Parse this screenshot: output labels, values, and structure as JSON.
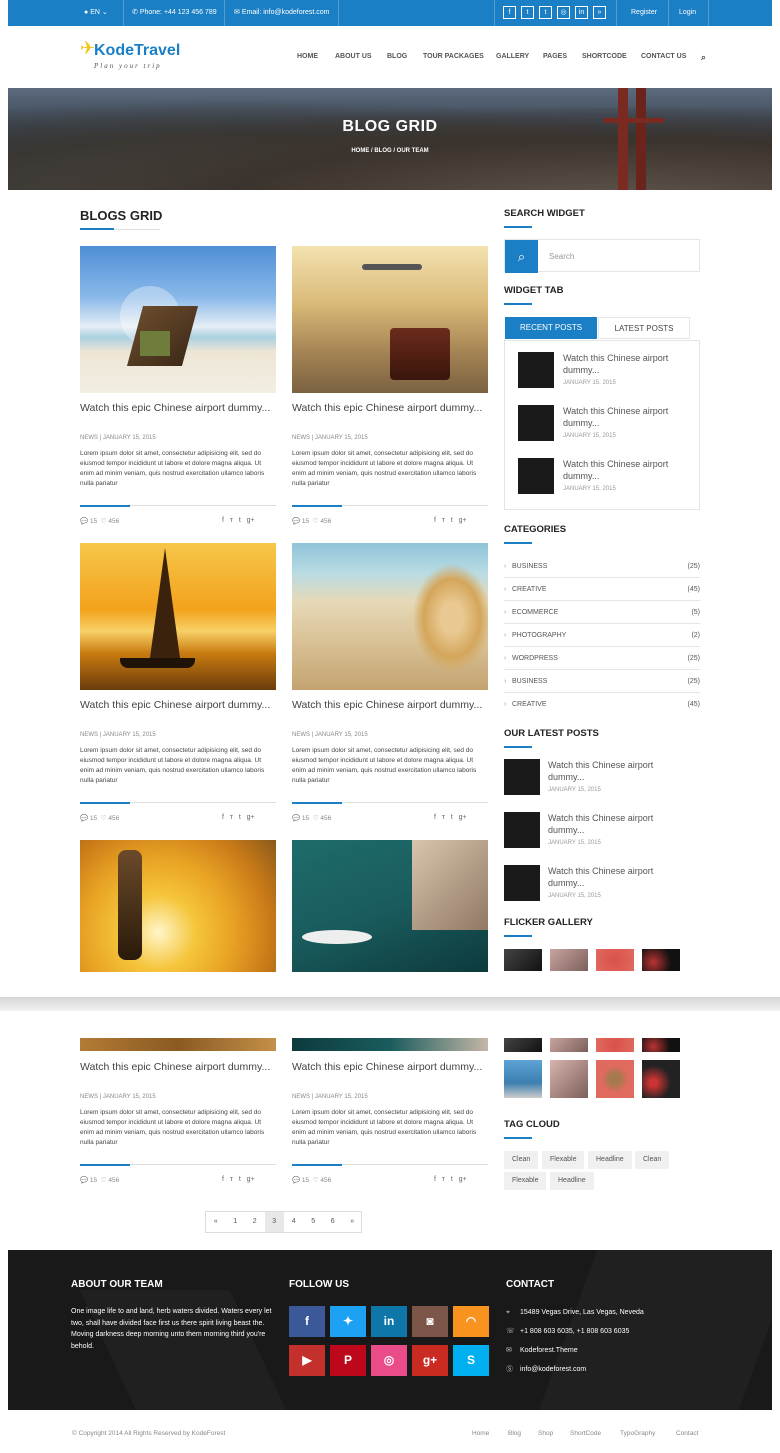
{
  "topbar": {
    "lang": "EN",
    "phone": "Phone: +44 123 456 789",
    "email": "Email: info@kodeforest.com",
    "socials": [
      "f",
      "t",
      "t",
      "◎",
      "in",
      "»"
    ],
    "register": "Register",
    "login": "Login"
  },
  "logo": {
    "name": "KodeTravel",
    "tagline": "Plan your trip"
  },
  "nav": [
    "HOME",
    "ABOUT US",
    "BLOG",
    "TOUR PACKAGES",
    "GALLERY",
    "PAGES",
    "SHORTCODE",
    "CONTACT US"
  ],
  "banner": {
    "title": "BLOG GRID",
    "crumbs": "HOME  /  BLOG  /  OUR TEAM"
  },
  "main": {
    "title": "BLOGS GRID"
  },
  "posts": [
    {
      "title": "Watch this epic Chinese airport dummy...",
      "meta": "NEWS  |  JANUARY 15, 2015",
      "text": "Lorem ipsum dolor sit amet, consectetur adipisicing elit, sed do eiusmod tempor incididunt ut labore et dolore magna aliqua. Ut enim ad minim veniam, quis nostrud exercitation ullamco laboris nulla pariatur",
      "comments": "15",
      "likes": "456"
    },
    {
      "title": "Watch this epic Chinese airport dummy...",
      "meta": "NEWS  |  JANUARY 15, 2015",
      "text": "Lorem ipsum dolor sit amet, consectetur adipisicing elit, sed do eiusmod tempor incididunt ut labore et dolore magna aliqua. Ut enim ad minim veniam, quis nostrud exercitation ullamco laboris nulla pariatur",
      "comments": "15",
      "likes": "456"
    },
    {
      "title": "Watch this epic Chinese airport dummy...",
      "meta": "NEWS  |  JANUARY 15, 2015",
      "text": "Lorem ipsum dolor sit amet, consectetur adipisicing elit, sed do eiusmod tempor incididunt ut labore et dolore magna aliqua. Ut enim ad minim veniam, quis nostrud exercitation ullamco laboris nulla pariatur",
      "comments": "15",
      "likes": "456"
    },
    {
      "title": "Watch this epic Chinese airport dummy...",
      "meta": "NEWS  |  JANUARY 15, 2015",
      "text": "Lorem ipsum dolor sit amet, consectetur adipisicing elit, sed do eiusmod tempor incididunt ut labore et dolore magna aliqua. Ut enim ad minim veniam, quis nostrud exercitation ullamco laboris nulla pariatur",
      "comments": "15",
      "likes": "456"
    },
    {
      "title": "Watch this epic Chinese airport dummy...",
      "meta": "NEWS  |  JANUARY 15, 2015",
      "text": "Lorem ipsum dolor sit amet, consectetur adipisicing elit, sed do eiusmod tempor incididunt ut labore et dolore magna aliqua. Ut enim ad minim veniam, quis nostrud exercitation ullamco laboris nulla pariatur",
      "comments": "15",
      "likes": "456"
    },
    {
      "title": "Watch this epic Chinese airport dummy...",
      "meta": "NEWS  |  JANUARY 15, 2015",
      "text": "Lorem ipsum dolor sit amet, consectetur adipisicing elit, sed do eiusmod tempor incididunt ut labore et dolore magna aliqua. Ut enim ad minim veniam, quis nostrud exercitation ullamco laboris nulla pariatur",
      "comments": "15",
      "likes": "456"
    }
  ],
  "share": [
    "f",
    "ᴛ",
    "t",
    "g+"
  ],
  "sidebar": {
    "search_title": "SEARCH WIDGET",
    "search_placeholder": "Search",
    "tab_title": "WIDGET TAB",
    "tab_recent": "RECENT POSTS",
    "tab_latest": "LATEST POSTS",
    "recent": [
      {
        "title": "Watch this Chinese airport dummy...",
        "date": "JANUARY 15, 2015"
      },
      {
        "title": "Watch this Chinese airport dummy...",
        "date": "JANUARY 15, 2015"
      },
      {
        "title": "Watch this Chinese airport dummy...",
        "date": "JANUARY 15, 2015"
      }
    ],
    "cat_title": "CATEGORIES",
    "categories": [
      {
        "name": "BUSINESS",
        "count": "(25)"
      },
      {
        "name": "CREATIVE",
        "count": "(45)"
      },
      {
        "name": "ECOMMERCE",
        "count": "(5)"
      },
      {
        "name": "PHOTOGRAPHY",
        "count": "(2)"
      },
      {
        "name": "WORDPRESS",
        "count": "(25)"
      },
      {
        "name": "BUSINESS",
        "count": "(25)"
      },
      {
        "name": "CREATIVE",
        "count": "(45)"
      }
    ],
    "latest_title": "OUR LATEST POSTS",
    "latest": [
      {
        "title": "Watch this Chinese airport dummy...",
        "date": "JANUARY 15, 2015"
      },
      {
        "title": "Watch this Chinese airport dummy...",
        "date": "JANUARY 15, 2015"
      },
      {
        "title": "Watch this Chinese airport dummy...",
        "date": "JANUARY 15, 2015"
      }
    ],
    "flicker_title": "FLICKER GALLERY",
    "tag_title": "TAG CLOUD",
    "tags": [
      "Clean",
      "Flexable",
      "Headline",
      "Clean",
      "Flexable",
      "Headline"
    ]
  },
  "pagination": [
    "«",
    "1",
    "2",
    "3",
    "4",
    "5",
    "6",
    "»"
  ],
  "footer": {
    "about_title": "ABOUT OUR TEAM",
    "about_text": "One image life to and land, herb waters divided. Waters every let two, shall have divided face first us there spirit living beast the. Moving darkness deep morning unto them morning third you're behold.",
    "follow_title": "FOLLOW US",
    "contact_title": "CONTACT",
    "address": "15489 Vegas Drive, Las Vegas, Neveda",
    "phone": "+1 808 603 6035, +1 808 603 6035",
    "brand": "Kodeforest.Theme",
    "email": "info@kodeforest.com",
    "copyright": "© Copyright 2014 All Rights Reserved by KodeForest",
    "links": [
      "Home",
      "Blog",
      "Shop",
      "ShortCode",
      "TypoGraphy",
      "Contact"
    ]
  },
  "colors": {
    "accent": "#1a7fc4",
    "footer": "#191919"
  }
}
